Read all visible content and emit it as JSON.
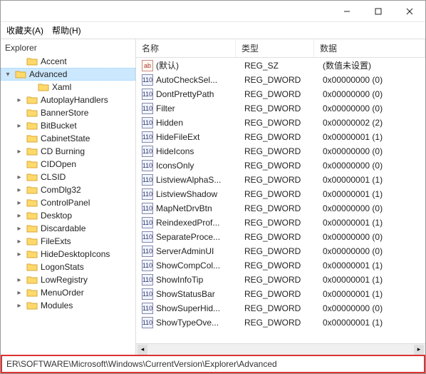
{
  "menu": {
    "favorites": "收藏夹(A)",
    "help": "帮助(H)"
  },
  "tree": {
    "header": "Explorer",
    "selected": "Advanced",
    "items": [
      {
        "label": "Accent",
        "indent": 1,
        "expander": ""
      },
      {
        "label": "Advanced",
        "indent": 1,
        "expander": "▾",
        "selected": true
      },
      {
        "label": "Xaml",
        "indent": 2,
        "expander": ""
      },
      {
        "label": "AutoplayHandlers",
        "indent": 1,
        "expander": "▸"
      },
      {
        "label": "BannerStore",
        "indent": 1,
        "expander": ""
      },
      {
        "label": "BitBucket",
        "indent": 1,
        "expander": "▸"
      },
      {
        "label": "CabinetState",
        "indent": 1,
        "expander": ""
      },
      {
        "label": "CD Burning",
        "indent": 1,
        "expander": "▸"
      },
      {
        "label": "CIDOpen",
        "indent": 1,
        "expander": ""
      },
      {
        "label": "CLSID",
        "indent": 1,
        "expander": "▸"
      },
      {
        "label": "ComDlg32",
        "indent": 1,
        "expander": "▸"
      },
      {
        "label": "ControlPanel",
        "indent": 1,
        "expander": "▸"
      },
      {
        "label": "Desktop",
        "indent": 1,
        "expander": "▸"
      },
      {
        "label": "Discardable",
        "indent": 1,
        "expander": "▸"
      },
      {
        "label": "FileExts",
        "indent": 1,
        "expander": "▸"
      },
      {
        "label": "HideDesktopIcons",
        "indent": 1,
        "expander": "▸"
      },
      {
        "label": "LogonStats",
        "indent": 1,
        "expander": ""
      },
      {
        "label": "LowRegistry",
        "indent": 1,
        "expander": "▸"
      },
      {
        "label": "MenuOrder",
        "indent": 1,
        "expander": "▸"
      },
      {
        "label": "Modules",
        "indent": 1,
        "expander": "▸"
      }
    ]
  },
  "list": {
    "columns": {
      "name": "名称",
      "type": "类型",
      "data": "数据"
    },
    "rows": [
      {
        "name": "(默认)",
        "type": "REG_SZ",
        "data": "(数值未设置)",
        "kind": "str"
      },
      {
        "name": "AutoCheckSel...",
        "type": "REG_DWORD",
        "data": "0x00000000 (0)",
        "kind": "dw"
      },
      {
        "name": "DontPrettyPath",
        "type": "REG_DWORD",
        "data": "0x00000000 (0)",
        "kind": "dw"
      },
      {
        "name": "Filter",
        "type": "REG_DWORD",
        "data": "0x00000000 (0)",
        "kind": "dw"
      },
      {
        "name": "Hidden",
        "type": "REG_DWORD",
        "data": "0x00000002 (2)",
        "kind": "dw"
      },
      {
        "name": "HideFileExt",
        "type": "REG_DWORD",
        "data": "0x00000001 (1)",
        "kind": "dw"
      },
      {
        "name": "HideIcons",
        "type": "REG_DWORD",
        "data": "0x00000000 (0)",
        "kind": "dw"
      },
      {
        "name": "IconsOnly",
        "type": "REG_DWORD",
        "data": "0x00000000 (0)",
        "kind": "dw"
      },
      {
        "name": "ListviewAlphaS...",
        "type": "REG_DWORD",
        "data": "0x00000001 (1)",
        "kind": "dw"
      },
      {
        "name": "ListviewShadow",
        "type": "REG_DWORD",
        "data": "0x00000001 (1)",
        "kind": "dw"
      },
      {
        "name": "MapNetDrvBtn",
        "type": "REG_DWORD",
        "data": "0x00000000 (0)",
        "kind": "dw"
      },
      {
        "name": "ReindexedProf...",
        "type": "REG_DWORD",
        "data": "0x00000001 (1)",
        "kind": "dw"
      },
      {
        "name": "SeparateProce...",
        "type": "REG_DWORD",
        "data": "0x00000000 (0)",
        "kind": "dw"
      },
      {
        "name": "ServerAdminUI",
        "type": "REG_DWORD",
        "data": "0x00000000 (0)",
        "kind": "dw"
      },
      {
        "name": "ShowCompCol...",
        "type": "REG_DWORD",
        "data": "0x00000001 (1)",
        "kind": "dw"
      },
      {
        "name": "ShowInfoTip",
        "type": "REG_DWORD",
        "data": "0x00000001 (1)",
        "kind": "dw"
      },
      {
        "name": "ShowStatusBar",
        "type": "REG_DWORD",
        "data": "0x00000001 (1)",
        "kind": "dw"
      },
      {
        "name": "ShowSuperHid...",
        "type": "REG_DWORD",
        "data": "0x00000000 (0)",
        "kind": "dw"
      },
      {
        "name": "ShowTypeOve...",
        "type": "REG_DWORD",
        "data": "0x00000001 (1)",
        "kind": "dw"
      }
    ]
  },
  "path": "ER\\SOFTWARE\\Microsoft\\Windows\\CurrentVersion\\Explorer\\Advanced"
}
